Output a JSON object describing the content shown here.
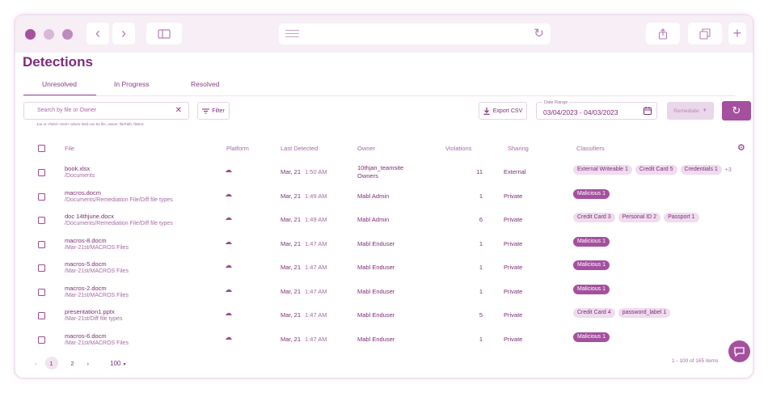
{
  "app": {
    "title": "Detections"
  },
  "tabs": [
    {
      "label": "Unresolved"
    },
    {
      "label": "In Progress"
    },
    {
      "label": "Resolved"
    }
  ],
  "toolbar": {
    "search_placeholder": "Search by file or Owner",
    "search_hint": "Joe or <field>:<text> where field can be file, owner, filePath, fileExt",
    "filter_label": "Filter",
    "export_label": "Export CSV",
    "date_range_label": "Date Range",
    "date_range_value": "03/04/2023 - 04/03/2023",
    "remediate_label": "Remediate"
  },
  "table": {
    "headers": {
      "file": "File",
      "platform": "Platform",
      "last_detected": "Last Detected",
      "owner": "Owner",
      "violations": "Violations",
      "sharing": "Sharing",
      "classifiers": "Classifiers"
    },
    "rows": [
      {
        "name": "book.xlsx",
        "path": "/Documents",
        "date": "Mar, 21",
        "time": "1:50 AM",
        "owner": "10thjan_teamsite",
        "owner2": "Owners",
        "violations": "11",
        "sharing": "External",
        "classifiers": [
          {
            "label": "External Writeable 1",
            "malicious": false
          },
          {
            "label": "Credit Card 5",
            "malicious": false
          },
          {
            "label": "Credentials 1",
            "malicious": false
          }
        ],
        "more": "+3"
      },
      {
        "name": "macros.docm",
        "path": "/Documents/Remediation File/Diff file types",
        "date": "Mar, 21",
        "time": "1:49 AM",
        "owner": "Mabl Admin",
        "owner2": "",
        "violations": "1",
        "sharing": "Private",
        "classifiers": [
          {
            "label": "Malicious 1",
            "malicious": true
          }
        ],
        "more": ""
      },
      {
        "name": "doc 14thjune.docx",
        "path": "/Documents/Remediation File/Diff file types",
        "date": "Mar, 21",
        "time": "1:49 AM",
        "owner": "Mabl Admin",
        "owner2": "",
        "violations": "6",
        "sharing": "Private",
        "classifiers": [
          {
            "label": "Credit Card 3",
            "malicious": false
          },
          {
            "label": "Personal ID 2",
            "malicious": false
          },
          {
            "label": "Passport 1",
            "malicious": false
          }
        ],
        "more": ""
      },
      {
        "name": "macros-8.docm",
        "path": "/Mar-21st/MACROS Files",
        "date": "Mar, 21",
        "time": "1:47 AM",
        "owner": "Mabl Enduser",
        "owner2": "",
        "violations": "1",
        "sharing": "Private",
        "classifiers": [
          {
            "label": "Malicious 1",
            "malicious": true
          }
        ],
        "more": ""
      },
      {
        "name": "macros-5.docm",
        "path": "/Mar-21st/MACROS Files",
        "date": "Mar, 21",
        "time": "1:47 AM",
        "owner": "Mabl Enduser",
        "owner2": "",
        "violations": "1",
        "sharing": "Private",
        "classifiers": [
          {
            "label": "Malicious 1",
            "malicious": true
          }
        ],
        "more": ""
      },
      {
        "name": "macros-2.docm",
        "path": "/Mar-21st/MACROS Files",
        "date": "Mar, 21",
        "time": "1:47 AM",
        "owner": "Mabl Enduser",
        "owner2": "",
        "violations": "1",
        "sharing": "Private",
        "classifiers": [
          {
            "label": "Malicious 1",
            "malicious": true
          }
        ],
        "more": ""
      },
      {
        "name": "presentation1.pptx",
        "path": "/Mar-21st/Diff file types",
        "date": "Mar, 21",
        "time": "1:47 AM",
        "owner": "Mabl Enduser",
        "owner2": "",
        "violations": "5",
        "sharing": "Private",
        "classifiers": [
          {
            "label": "Credit Card 4",
            "malicious": false
          },
          {
            "label": "password_label 1",
            "malicious": false
          }
        ],
        "more": ""
      },
      {
        "name": "macros-6.docm",
        "path": "/Mar-21st/MACROS Files",
        "date": "Mar, 21",
        "time": "1:47 AM",
        "owner": "Mabl Enduser",
        "owner2": "",
        "violations": "1",
        "sharing": "Private",
        "classifiers": [
          {
            "label": "Malicious 1",
            "malicious": true
          }
        ],
        "more": ""
      }
    ]
  },
  "pagination": {
    "pages": [
      "1",
      "2"
    ],
    "per_page": "100",
    "count": "1 - 100 of 165 items"
  },
  "colors": {
    "brand": "#a4509f",
    "text": "#7d2b7a",
    "chip": "#efdcee",
    "dots": [
      "#a4509f",
      "#d9b7d7",
      "#c089bd"
    ]
  },
  "icons": {
    "back": "chevron-left-icon",
    "forward": "chevron-right-icon",
    "sidebar": "sidebar-icon",
    "reload": "reload-icon",
    "share": "share-icon",
    "tabs": "tabs-icon",
    "new_tab": "plus-icon",
    "clear": "close-icon",
    "filter": "filter-icon",
    "download": "download-icon",
    "calendar": "calendar-icon",
    "refresh": "refresh-icon",
    "settings": "gear-icon",
    "platform": "cloud-icon",
    "chat": "chat-icon"
  }
}
